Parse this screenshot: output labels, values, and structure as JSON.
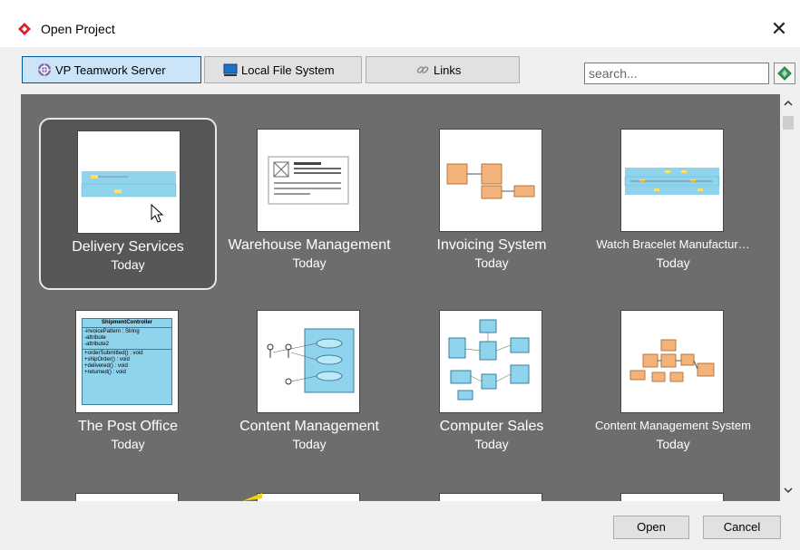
{
  "dialog": {
    "title": "Open Project",
    "close_label": "✕"
  },
  "tabs": [
    {
      "label": "VP Teamwork Server",
      "active": true
    },
    {
      "label": "Local File System",
      "active": false
    },
    {
      "label": "Links",
      "active": false
    }
  ],
  "search": {
    "placeholder": "search...",
    "value": ""
  },
  "projects": [
    {
      "name": "Delivery Services",
      "date": "Today",
      "selected": true
    },
    {
      "name": "Warehouse Management",
      "date": "Today",
      "selected": false
    },
    {
      "name": "Invoicing System",
      "date": "Today",
      "selected": false
    },
    {
      "name": "Watch Bracelet Manufactur…",
      "date": "Today",
      "selected": false
    },
    {
      "name": "The Post Office",
      "date": "Today",
      "selected": false
    },
    {
      "name": "Content Management",
      "date": "Today",
      "selected": false
    },
    {
      "name": "Computer Sales",
      "date": "Today",
      "selected": false
    },
    {
      "name": "Content Management System",
      "date": "Today",
      "selected": false
    }
  ],
  "class_thumb": {
    "class_name": "ShipmentController",
    "attributes": [
      "-invoicePattern : String",
      "-attribute",
      "-attribute2"
    ],
    "operations": [
      "+orderSubmitted() : void",
      "+shipOrder() : void",
      "+delivered() : void",
      "+returned() : void"
    ]
  },
  "buttons": {
    "open_label": "Open",
    "cancel_label": "Cancel"
  },
  "colors": {
    "gallery_bg": "#6d6d6d",
    "selected_bg": "#575757",
    "active_tab": "#cce4f7",
    "diagram_blue": "#8fd3ec",
    "diagram_orange": "#f2b27a"
  }
}
